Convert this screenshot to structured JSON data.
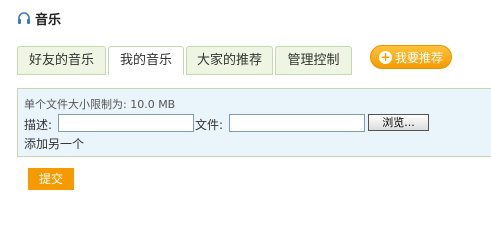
{
  "header": {
    "title": "音乐",
    "icon": "headphones-icon"
  },
  "tabs": [
    {
      "label": "好友的音乐",
      "active": false
    },
    {
      "label": "我的音乐",
      "active": true
    },
    {
      "label": "大家的推荐",
      "active": false
    },
    {
      "label": "管理控制",
      "active": false
    }
  ],
  "recommend": {
    "label": "我要推荐",
    "icon": "plus-icon"
  },
  "upload": {
    "limit_text": "单个文件大小限制为: 10.0 MB",
    "description_label": "描述:",
    "description_value": "",
    "file_label": "文件:",
    "file_value": "",
    "browse_label": "浏览...",
    "add_another_label": "添加另一个"
  },
  "submit_label": "提交",
  "colors": {
    "accent": "#f59b00",
    "tab_bg": "#eef6e3",
    "panel_bg": "#eaf4fb",
    "border": "#c6d8ae"
  }
}
